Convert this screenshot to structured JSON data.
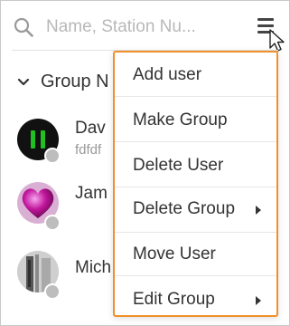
{
  "search": {
    "placeholder": "Name, Station Nu..."
  },
  "group": {
    "name": "Group N"
  },
  "users": [
    {
      "name": "Dav",
      "sub": "fdfdf"
    },
    {
      "name": "Jam",
      "sub": ""
    },
    {
      "name": "Mich",
      "sub": ""
    }
  ],
  "menu": {
    "items": [
      {
        "label": "Add user",
        "has_submenu": false
      },
      {
        "label": "Make Group",
        "has_submenu": false
      },
      {
        "label": "Delete User",
        "has_submenu": false
      },
      {
        "label": "Delete Group",
        "has_submenu": true
      },
      {
        "label": "Move User",
        "has_submenu": false
      },
      {
        "label": "Edit Group",
        "has_submenu": true
      }
    ]
  },
  "colors": {
    "menu_border": "#f0902a",
    "status_dot": "#bdbdbd",
    "online_green": "#1fc01f"
  },
  "icons": {
    "search": "search-icon",
    "menu": "hamburger-menu-icon",
    "chevron": "chevron-down-icon",
    "submenu_arrow": "caret-right-icon",
    "cursor": "mouse-cursor-icon"
  }
}
